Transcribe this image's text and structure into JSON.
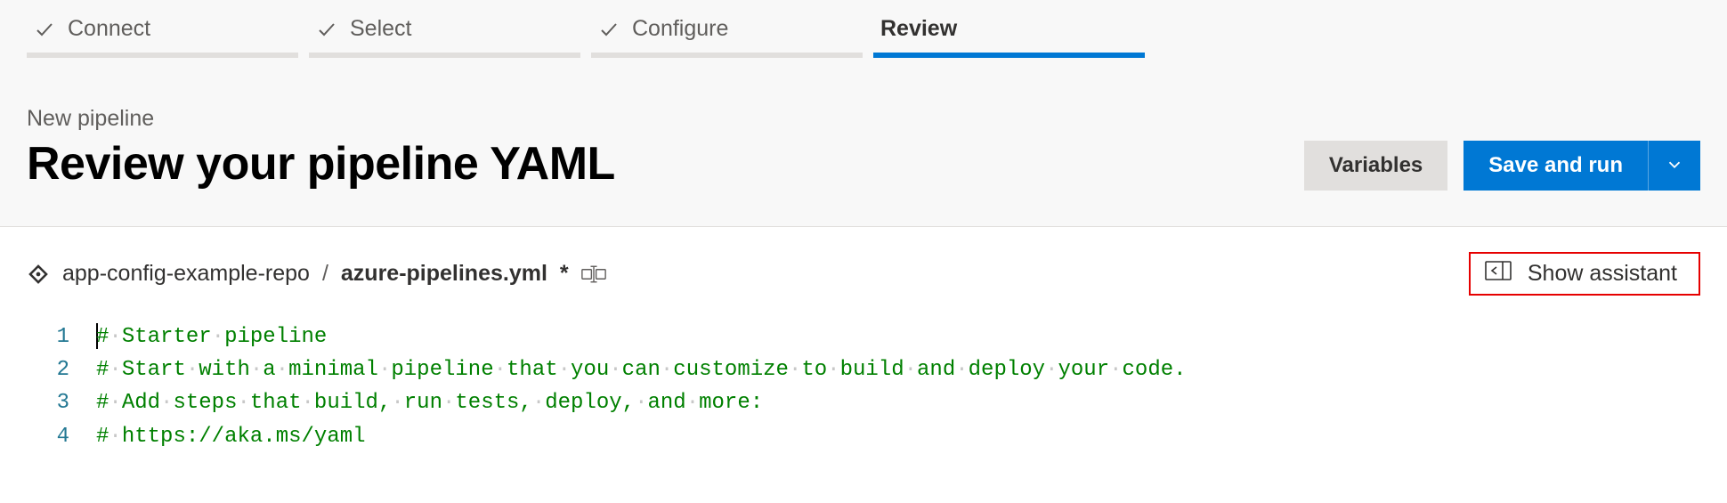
{
  "steps": [
    {
      "label": "Connect",
      "completed": true,
      "active": false
    },
    {
      "label": "Select",
      "completed": true,
      "active": false
    },
    {
      "label": "Configure",
      "completed": true,
      "active": false
    },
    {
      "label": "Review",
      "completed": false,
      "active": true
    }
  ],
  "header": {
    "crumb": "New pipeline",
    "title": "Review your pipeline YAML",
    "variables_label": "Variables",
    "save_run_label": "Save and run"
  },
  "file": {
    "repo": "app-config-example-repo",
    "separator": "/",
    "name": "azure-pipelines.yml",
    "dirty_marker": "*",
    "show_assistant_label": "Show assistant"
  },
  "editor": {
    "lines": [
      {
        "n": "1",
        "text": "# Starter pipeline"
      },
      {
        "n": "2",
        "text": "# Start with a minimal pipeline that you can customize to build and deploy your code."
      },
      {
        "n": "3",
        "text": "# Add steps that build, run tests, deploy, and more:"
      },
      {
        "n": "4",
        "text": "# https://aka.ms/yaml"
      }
    ]
  }
}
